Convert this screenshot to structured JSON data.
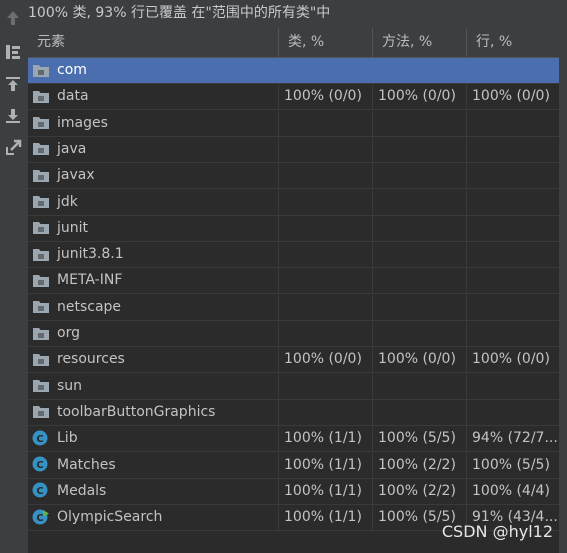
{
  "summary": "100% 类, 93% 行已覆盖 在\"范围中的所有类\"中",
  "toolbar": {
    "tools": [
      "arrow-up-icon",
      "flatten-packages-icon",
      "import-icon",
      "export-icon",
      "navigate-icon"
    ]
  },
  "table": {
    "columns": [
      "元素",
      "类, %",
      "方法, %",
      "行, %"
    ],
    "rows": [
      {
        "icon": "package-icon",
        "name": "com",
        "class": "",
        "method": "",
        "line": "",
        "selected": true
      },
      {
        "icon": "package-icon",
        "name": "data",
        "class": "100% (0/0)",
        "method": "100% (0/0)",
        "line": "100% (0/0)"
      },
      {
        "icon": "package-icon",
        "name": "images",
        "class": "",
        "method": "",
        "line": ""
      },
      {
        "icon": "package-icon",
        "name": "java",
        "class": "",
        "method": "",
        "line": ""
      },
      {
        "icon": "package-icon",
        "name": "javax",
        "class": "",
        "method": "",
        "line": ""
      },
      {
        "icon": "package-icon",
        "name": "jdk",
        "class": "",
        "method": "",
        "line": ""
      },
      {
        "icon": "package-icon",
        "name": "junit",
        "class": "",
        "method": "",
        "line": ""
      },
      {
        "icon": "package-icon",
        "name": "junit3.8.1",
        "class": "",
        "method": "",
        "line": ""
      },
      {
        "icon": "package-icon",
        "name": "META-INF",
        "class": "",
        "method": "",
        "line": ""
      },
      {
        "icon": "package-icon",
        "name": "netscape",
        "class": "",
        "method": "",
        "line": ""
      },
      {
        "icon": "package-icon",
        "name": "org",
        "class": "",
        "method": "",
        "line": ""
      },
      {
        "icon": "package-icon",
        "name": "resources",
        "class": "100% (0/0)",
        "method": "100% (0/0)",
        "line": "100% (0/0)"
      },
      {
        "icon": "package-icon",
        "name": "sun",
        "class": "",
        "method": "",
        "line": ""
      },
      {
        "icon": "package-icon",
        "name": "toolbarButtonGraphics",
        "class": "",
        "method": "",
        "line": ""
      },
      {
        "icon": "class-icon",
        "name": "Lib",
        "class": "100% (1/1)",
        "method": "100% (5/5)",
        "line": "94% (72/7..."
      },
      {
        "icon": "class-icon",
        "name": "Matches",
        "class": "100% (1/1)",
        "method": "100% (2/2)",
        "line": "100% (5/5)"
      },
      {
        "icon": "class-icon",
        "name": "Medals",
        "class": "100% (1/1)",
        "method": "100% (2/2)",
        "line": "100% (4/4)"
      },
      {
        "icon": "main-class-icon",
        "name": "OlympicSearch",
        "class": "100% (1/1)",
        "method": "100% (5/5)",
        "line": "91% (43/4..."
      }
    ]
  },
  "watermark": "CSDN @hyl12",
  "colors": {
    "background": "#3c3f41",
    "table_background": "#2b2b2b",
    "selection": "#4b6eaf",
    "class_icon": "#3592c4",
    "main_badge": "#62b543"
  }
}
